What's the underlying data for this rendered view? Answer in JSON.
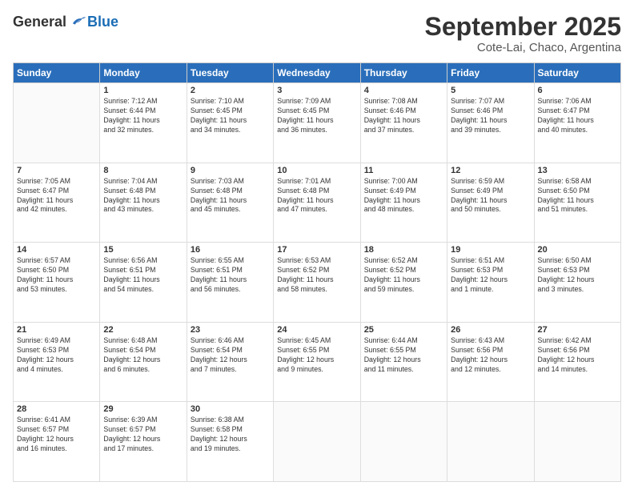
{
  "header": {
    "logo_general": "General",
    "logo_blue": "Blue",
    "month_title": "September 2025",
    "location": "Cote-Lai, Chaco, Argentina"
  },
  "days_of_week": [
    "Sunday",
    "Monday",
    "Tuesday",
    "Wednesday",
    "Thursday",
    "Friday",
    "Saturday"
  ],
  "weeks": [
    [
      {
        "day": "",
        "info": ""
      },
      {
        "day": "1",
        "info": "Sunrise: 7:12 AM\nSunset: 6:44 PM\nDaylight: 11 hours\nand 32 minutes."
      },
      {
        "day": "2",
        "info": "Sunrise: 7:10 AM\nSunset: 6:45 PM\nDaylight: 11 hours\nand 34 minutes."
      },
      {
        "day": "3",
        "info": "Sunrise: 7:09 AM\nSunset: 6:45 PM\nDaylight: 11 hours\nand 36 minutes."
      },
      {
        "day": "4",
        "info": "Sunrise: 7:08 AM\nSunset: 6:46 PM\nDaylight: 11 hours\nand 37 minutes."
      },
      {
        "day": "5",
        "info": "Sunrise: 7:07 AM\nSunset: 6:46 PM\nDaylight: 11 hours\nand 39 minutes."
      },
      {
        "day": "6",
        "info": "Sunrise: 7:06 AM\nSunset: 6:47 PM\nDaylight: 11 hours\nand 40 minutes."
      }
    ],
    [
      {
        "day": "7",
        "info": "Sunrise: 7:05 AM\nSunset: 6:47 PM\nDaylight: 11 hours\nand 42 minutes."
      },
      {
        "day": "8",
        "info": "Sunrise: 7:04 AM\nSunset: 6:48 PM\nDaylight: 11 hours\nand 43 minutes."
      },
      {
        "day": "9",
        "info": "Sunrise: 7:03 AM\nSunset: 6:48 PM\nDaylight: 11 hours\nand 45 minutes."
      },
      {
        "day": "10",
        "info": "Sunrise: 7:01 AM\nSunset: 6:48 PM\nDaylight: 11 hours\nand 47 minutes."
      },
      {
        "day": "11",
        "info": "Sunrise: 7:00 AM\nSunset: 6:49 PM\nDaylight: 11 hours\nand 48 minutes."
      },
      {
        "day": "12",
        "info": "Sunrise: 6:59 AM\nSunset: 6:49 PM\nDaylight: 11 hours\nand 50 minutes."
      },
      {
        "day": "13",
        "info": "Sunrise: 6:58 AM\nSunset: 6:50 PM\nDaylight: 11 hours\nand 51 minutes."
      }
    ],
    [
      {
        "day": "14",
        "info": "Sunrise: 6:57 AM\nSunset: 6:50 PM\nDaylight: 11 hours\nand 53 minutes."
      },
      {
        "day": "15",
        "info": "Sunrise: 6:56 AM\nSunset: 6:51 PM\nDaylight: 11 hours\nand 54 minutes."
      },
      {
        "day": "16",
        "info": "Sunrise: 6:55 AM\nSunset: 6:51 PM\nDaylight: 11 hours\nand 56 minutes."
      },
      {
        "day": "17",
        "info": "Sunrise: 6:53 AM\nSunset: 6:52 PM\nDaylight: 11 hours\nand 58 minutes."
      },
      {
        "day": "18",
        "info": "Sunrise: 6:52 AM\nSunset: 6:52 PM\nDaylight: 11 hours\nand 59 minutes."
      },
      {
        "day": "19",
        "info": "Sunrise: 6:51 AM\nSunset: 6:53 PM\nDaylight: 12 hours\nand 1 minute."
      },
      {
        "day": "20",
        "info": "Sunrise: 6:50 AM\nSunset: 6:53 PM\nDaylight: 12 hours\nand 3 minutes."
      }
    ],
    [
      {
        "day": "21",
        "info": "Sunrise: 6:49 AM\nSunset: 6:53 PM\nDaylight: 12 hours\nand 4 minutes."
      },
      {
        "day": "22",
        "info": "Sunrise: 6:48 AM\nSunset: 6:54 PM\nDaylight: 12 hours\nand 6 minutes."
      },
      {
        "day": "23",
        "info": "Sunrise: 6:46 AM\nSunset: 6:54 PM\nDaylight: 12 hours\nand 7 minutes."
      },
      {
        "day": "24",
        "info": "Sunrise: 6:45 AM\nSunset: 6:55 PM\nDaylight: 12 hours\nand 9 minutes."
      },
      {
        "day": "25",
        "info": "Sunrise: 6:44 AM\nSunset: 6:55 PM\nDaylight: 12 hours\nand 11 minutes."
      },
      {
        "day": "26",
        "info": "Sunrise: 6:43 AM\nSunset: 6:56 PM\nDaylight: 12 hours\nand 12 minutes."
      },
      {
        "day": "27",
        "info": "Sunrise: 6:42 AM\nSunset: 6:56 PM\nDaylight: 12 hours\nand 14 minutes."
      }
    ],
    [
      {
        "day": "28",
        "info": "Sunrise: 6:41 AM\nSunset: 6:57 PM\nDaylight: 12 hours\nand 16 minutes."
      },
      {
        "day": "29",
        "info": "Sunrise: 6:39 AM\nSunset: 6:57 PM\nDaylight: 12 hours\nand 17 minutes."
      },
      {
        "day": "30",
        "info": "Sunrise: 6:38 AM\nSunset: 6:58 PM\nDaylight: 12 hours\nand 19 minutes."
      },
      {
        "day": "",
        "info": ""
      },
      {
        "day": "",
        "info": ""
      },
      {
        "day": "",
        "info": ""
      },
      {
        "day": "",
        "info": ""
      }
    ]
  ]
}
